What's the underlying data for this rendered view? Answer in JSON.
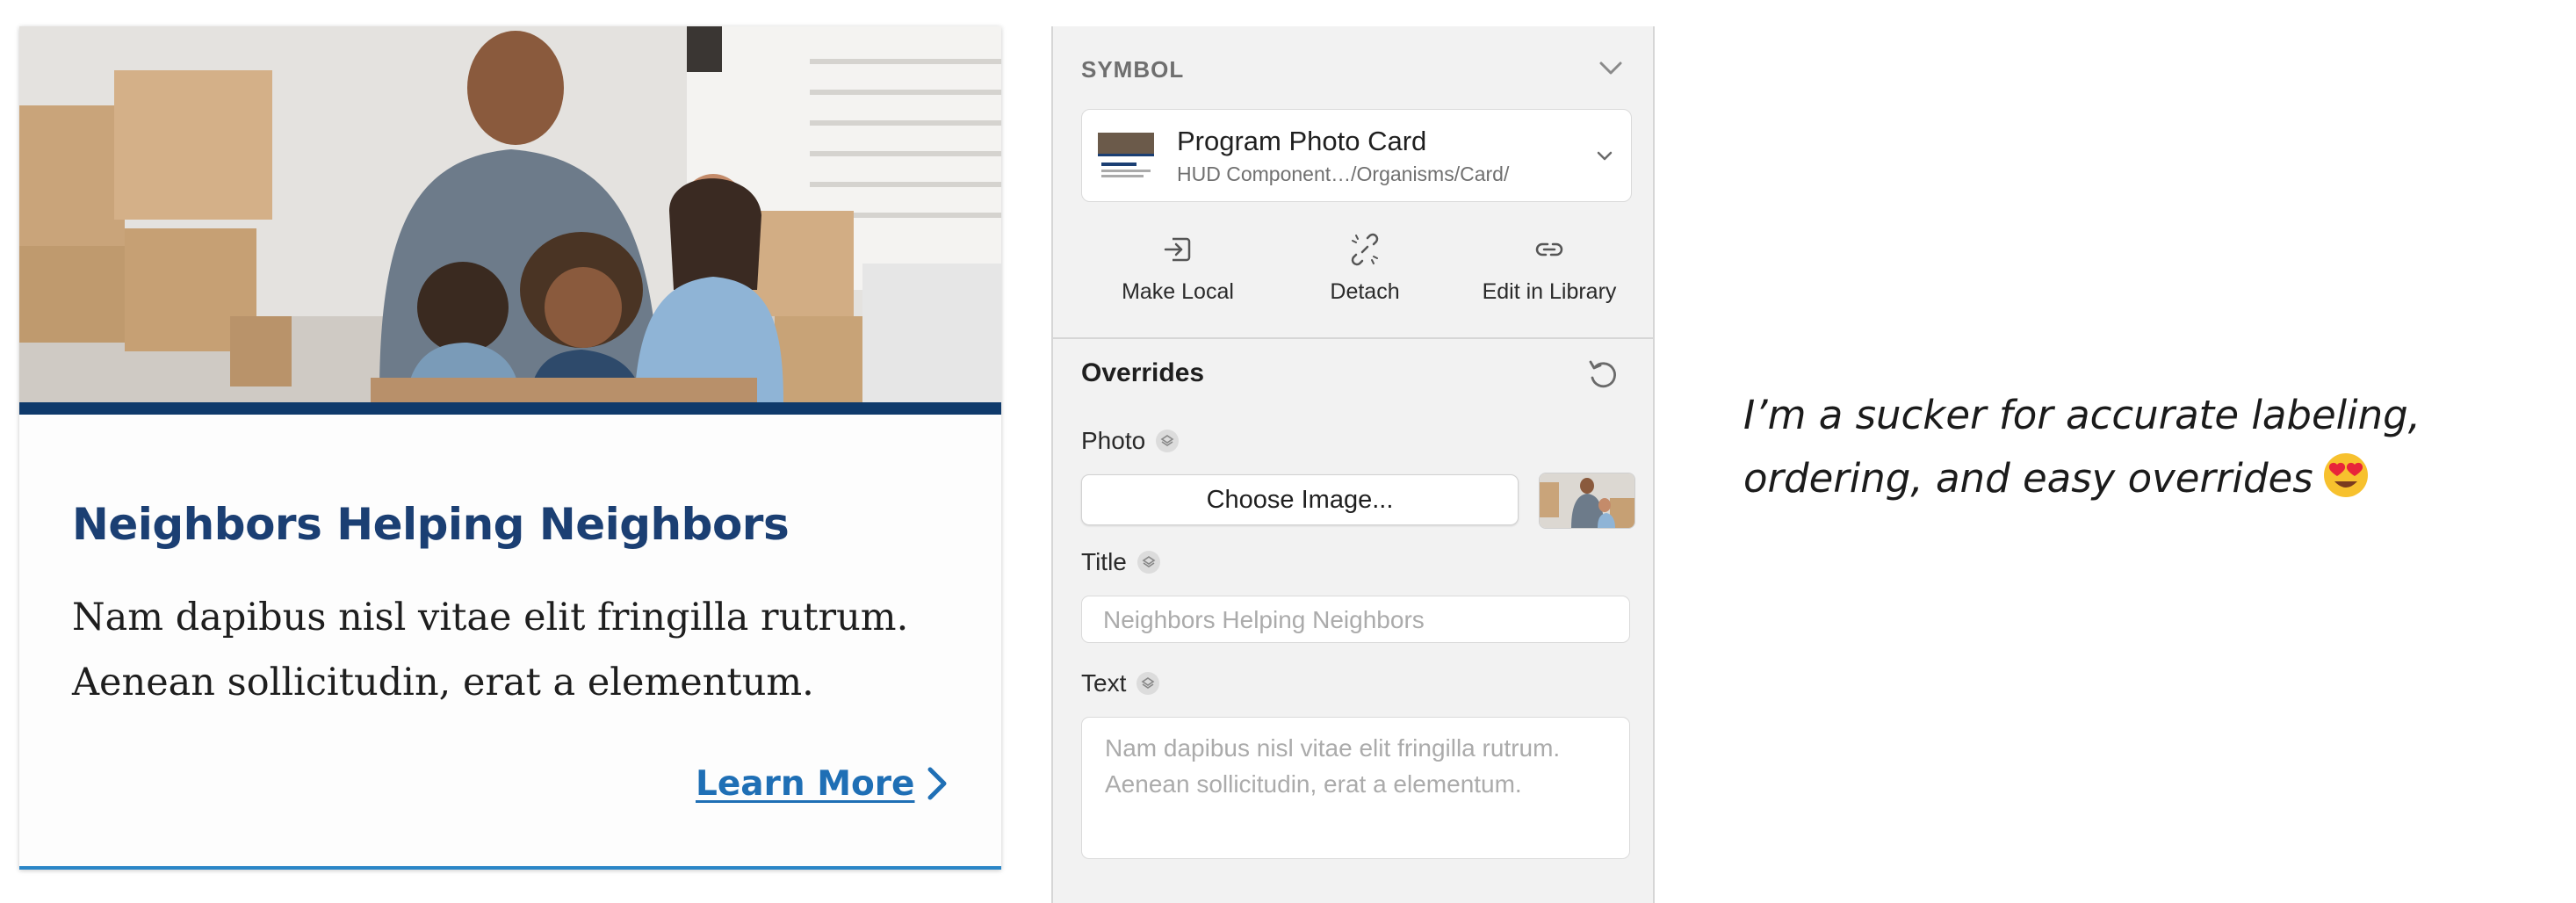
{
  "card": {
    "title": "Neighbors Helping Neighbors",
    "body": "Nam dapibus nisl vitae elit fringilla rutrum. Aenean sollicitudin, erat a elementum.",
    "link_label": "Learn More"
  },
  "panel": {
    "section_label": "SYMBOL",
    "symbol": {
      "name": "Program Photo Card",
      "path": "HUD Component…/Organisms/Card/"
    },
    "actions": [
      {
        "label": "Make Local",
        "icon": "make-local-icon"
      },
      {
        "label": "Detach",
        "icon": "detach-icon"
      },
      {
        "label": "Edit in Library",
        "icon": "edit-in-library-icon"
      }
    ],
    "overrides": {
      "title": "Overrides",
      "photo_label": "Photo",
      "choose_image_label": "Choose Image...",
      "title_label": "Title",
      "title_value": "Neighbors Helping Neighbors",
      "text_label": "Text",
      "text_value": "Nam dapibus nisl vitae elit fringilla rutrum. Aenean sollicitudin, erat a elementum."
    }
  },
  "caption": {
    "text": "I’m a sucker for accurate labeling, ordering, and easy overrides",
    "emoji": "heart-eyes-emoji"
  },
  "colors": {
    "card_title": "#1b3f73",
    "card_bar": "#0f3a6b",
    "link": "#1f6fb5",
    "card_bottom_border": "#2b86c7",
    "panel_bg": "#f2f2f2"
  }
}
